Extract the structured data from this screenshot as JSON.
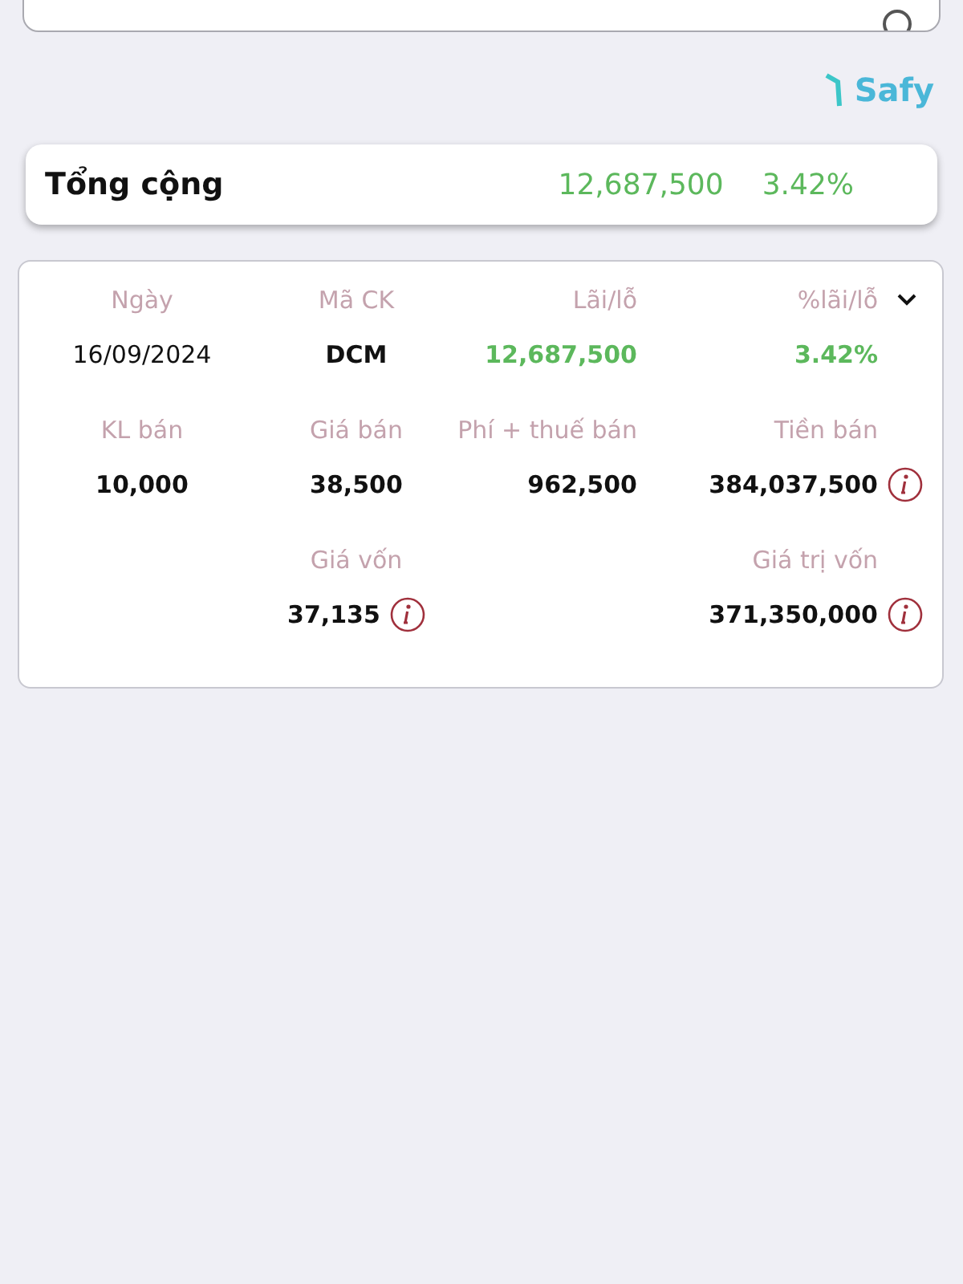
{
  "brand": {
    "name": "Safy"
  },
  "total": {
    "label": "Tổng cộng",
    "amount": "12,687,500",
    "percent": "3.42%"
  },
  "record": {
    "expanded": true,
    "rows": [
      [
        {
          "kind": "date",
          "label": "Ngày",
          "value": "16/09/2024",
          "info": false
        },
        {
          "kind": "number",
          "label": "Mã CK",
          "value": "DCM",
          "info": false
        },
        {
          "kind": "gain",
          "label": "Lãi/lỗ",
          "value": "12,687,500",
          "info": false
        },
        {
          "kind": "gain",
          "label": "%lãi/lỗ",
          "value": "3.42%",
          "info": false
        }
      ],
      [
        {
          "kind": "number",
          "label": "KL bán",
          "value": "10,000",
          "info": false
        },
        {
          "kind": "number",
          "label": "Giá bán",
          "value": "38,500",
          "info": false
        },
        {
          "kind": "number",
          "label": "Phí + thuế bán",
          "value": "962,500",
          "info": false
        },
        {
          "kind": "number",
          "label": "Tiền bán",
          "value": "384,037,500",
          "info": true
        }
      ],
      [
        {
          "kind": "empty"
        },
        {
          "kind": "number",
          "label": "Giá vốn",
          "value": "37,135",
          "info": true
        },
        {
          "kind": "empty"
        },
        {
          "kind": "number",
          "label": "Giá trị vốn",
          "value": "371,350,000",
          "info": true
        }
      ]
    ]
  }
}
